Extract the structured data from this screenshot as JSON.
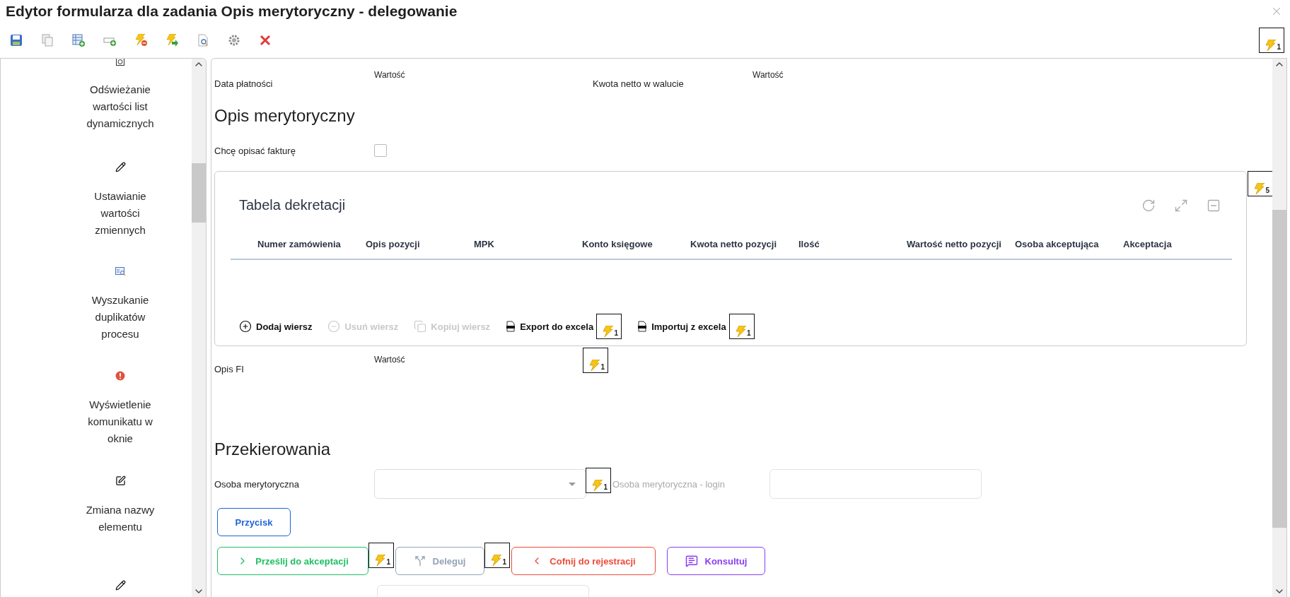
{
  "window": {
    "title": "Edytor formularza dla zadania Opis merytoryczny - delegowanie"
  },
  "toolbar": {
    "badge": "1"
  },
  "sidebar": {
    "items": [
      {
        "label": "Odświeżanie wartości list dynamicznych"
      },
      {
        "label": "Ustawianie wartości zmiennych"
      },
      {
        "label": "Wyszukanie duplikatów procesu"
      },
      {
        "label": "Wyświetlenie komunikatu w oknie"
      },
      {
        "label": "Zmiana nazwy elementu"
      }
    ]
  },
  "payment_row": [
    {
      "label": "Data płatności",
      "value": "Wartość"
    },
    {
      "label": "Kwota netto w walucie",
      "value": "Wartość"
    }
  ],
  "description": {
    "heading": "Opis merytoryczny",
    "checkbox": {
      "label": "Chcę opisać fakturę",
      "checked": false
    },
    "table": {
      "title": "Tabela dekretacji",
      "badge": "5",
      "columns": [
        "Numer zamówienia",
        "Opis pozycji",
        "MPK",
        "Konto księgowe",
        "Kwota netto pozycji",
        "Ilość",
        "Wartość netto pozycji",
        "Osoba akceptująca",
        "Akceptacja"
      ],
      "actions": [
        {
          "label": "Dodaj wiersz",
          "kind": "add",
          "disabled": false
        },
        {
          "label": "Usuń wiersz",
          "kind": "remove",
          "disabled": true
        },
        {
          "label": "Kopiuj wiersz",
          "kind": "copy",
          "disabled": true
        },
        {
          "label": "Export do excela",
          "kind": "excel",
          "disabled": false,
          "badge": "1"
        },
        {
          "label": "Importuj z excela",
          "kind": "excel",
          "disabled": false,
          "badge": "1"
        }
      ]
    },
    "opis_fi": {
      "label": "Opis FI",
      "value": "Wartość",
      "badge": "1"
    }
  },
  "redirects": {
    "heading": "Przekierowania",
    "person": {
      "label": "Osoba merytoryczna",
      "badge": "1"
    },
    "login": {
      "label": "Osoba merytoryczna - login",
      "disabled": true
    },
    "button": {
      "label": "Przycisk"
    },
    "actions": [
      {
        "label": "Prześlij do akceptacji",
        "kind": "forward",
        "disabled": false,
        "badge": "1"
      },
      {
        "label": "Deleguj",
        "kind": "delegate",
        "disabled": true,
        "badge": "1"
      },
      {
        "label": "Cofnij do rejestracji",
        "kind": "back",
        "disabled": false
      },
      {
        "label": "Konsultuj",
        "kind": "consult",
        "disabled": false
      }
    ]
  }
}
